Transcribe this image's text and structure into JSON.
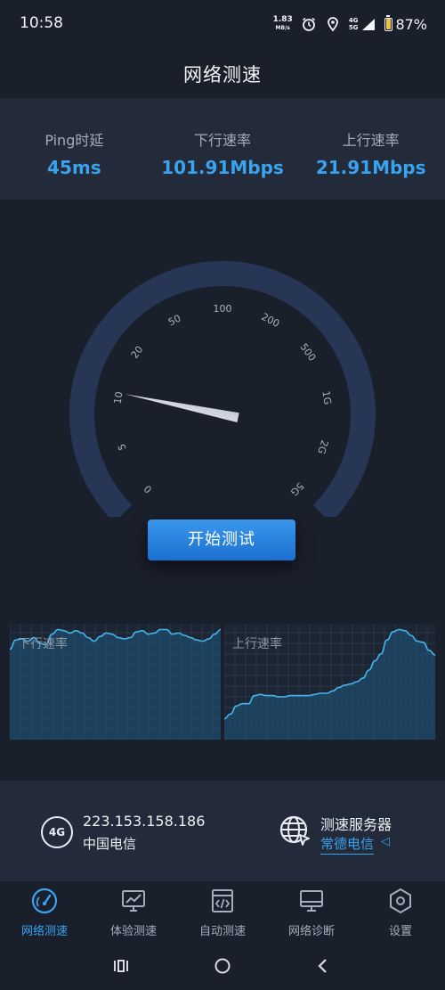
{
  "status_bar": {
    "time": "10:58",
    "net_speed_value": "1.83",
    "net_speed_unit": "MB/s",
    "net_type_top": "4G",
    "net_type_bottom": "5G",
    "battery": "87%",
    "battery_level": 0.87,
    "icons": [
      "alarm-icon",
      "location-icon",
      "signal-icon",
      "battery-icon"
    ]
  },
  "header": {
    "title": "网络测速"
  },
  "stats": [
    {
      "label": "Ping时延",
      "value": "45ms"
    },
    {
      "label": "下行速率",
      "value": "101.91Mbps"
    },
    {
      "label": "上行速率",
      "value": "21.91Mbps"
    }
  ],
  "gauge": {
    "ticks": [
      "0",
      "5",
      "10",
      "20",
      "50",
      "100",
      "200",
      "500",
      "1G",
      "2G",
      "5G"
    ],
    "needle_fraction": 0.21
  },
  "actions": {
    "start_label": "开始测试"
  },
  "charts": {
    "down": {
      "label": "下行速率",
      "samples": [
        0.78,
        0.86,
        0.87,
        0.85,
        0.88,
        0.83,
        0.82,
        0.91,
        0.95,
        0.94,
        0.92,
        0.94,
        0.92,
        0.88,
        0.85,
        0.89,
        0.92,
        0.91,
        0.88,
        0.87,
        0.88,
        0.93,
        0.94,
        0.91,
        0.92,
        0.95,
        0.95,
        0.91,
        0.92,
        0.9,
        0.88,
        0.86,
        0.85,
        0.87,
        0.91,
        0.95
      ]
    },
    "up": {
      "label": "上行速率",
      "samples": [
        0.18,
        0.22,
        0.29,
        0.31,
        0.31,
        0.38,
        0.39,
        0.38,
        0.38,
        0.37,
        0.37,
        0.38,
        0.38,
        0.38,
        0.38,
        0.39,
        0.4,
        0.4,
        0.42,
        0.45,
        0.47,
        0.48,
        0.5,
        0.53,
        0.6,
        0.68,
        0.74,
        0.86,
        0.93,
        0.95,
        0.94,
        0.9,
        0.85,
        0.84,
        0.77,
        0.73
      ]
    }
  },
  "connection": {
    "network_badge": "4G",
    "ip": "223.153.158.186",
    "carrier": "中国电信",
    "server_label": "测速服务器",
    "server_name": "常德电信"
  },
  "nav": [
    {
      "label": "网络测速",
      "icon": "speedometer-icon",
      "active": true
    },
    {
      "label": "体验测速",
      "icon": "monitor-chart-icon",
      "active": false
    },
    {
      "label": "自动测速",
      "icon": "code-document-icon",
      "active": false
    },
    {
      "label": "网络诊断",
      "icon": "desktop-icon",
      "active": false
    },
    {
      "label": "设置",
      "icon": "hexagon-settings-icon",
      "active": false
    }
  ],
  "colors": {
    "background": "#1a1f2c",
    "panel": "#232a39",
    "accent": "#3aa3ef",
    "gauge_track": "#283656"
  }
}
